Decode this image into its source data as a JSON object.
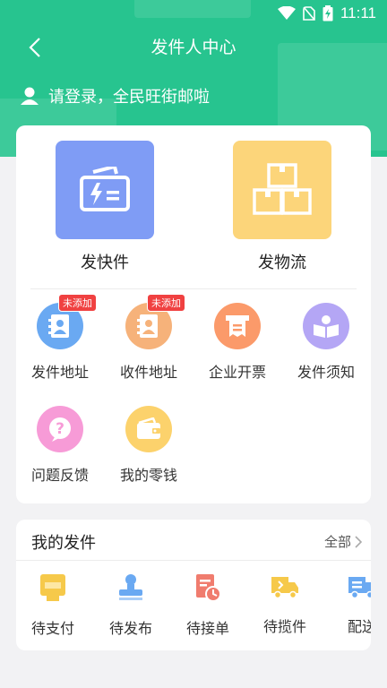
{
  "status_bar": {
    "time": "11:11"
  },
  "header": {
    "title": "发件人中心",
    "login_text": "请登录，全民旺街邮啦"
  },
  "big_actions": [
    {
      "label": "发快件",
      "color": "#7f9cf5"
    },
    {
      "label": "发物流",
      "color": "#fcd57a"
    }
  ],
  "services": [
    {
      "label": "发件地址",
      "badge": "未添加",
      "color": "#6aa9f2"
    },
    {
      "label": "收件地址",
      "badge": "未添加",
      "color": "#f6b27a"
    },
    {
      "label": "企业开票",
      "color": "#fb9a6a"
    },
    {
      "label": "发件须知",
      "color": "#b4a6f5"
    },
    {
      "label": "问题反馈",
      "color": "#f79bd7"
    },
    {
      "label": "我的零钱",
      "color": "#fcd26c"
    }
  ],
  "my_orders": {
    "title": "我的发件",
    "all_label": "全部",
    "items": [
      {
        "label": "待支付",
        "color": "#f6c94a"
      },
      {
        "label": "待发布",
        "color": "#6aa9f2"
      },
      {
        "label": "待接单",
        "color": "#f07c6e"
      },
      {
        "label": "待揽件",
        "color": "#f6c94a"
      },
      {
        "label": "配送",
        "color": "#6aa9f2"
      }
    ]
  }
}
